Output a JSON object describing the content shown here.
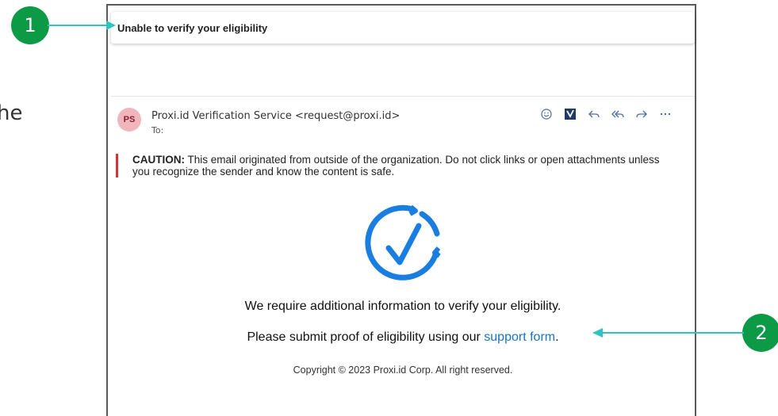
{
  "background": {
    "partial_text": "he"
  },
  "email": {
    "subject": "Unable to verify your eligibility",
    "sender": {
      "initials": "PS",
      "from": "Proxi.id Verification Service <request@proxi.id>",
      "to_label": "To:"
    },
    "toolbar": [
      {
        "icon": "emoji-icon"
      },
      {
        "icon": "forms-icon"
      },
      {
        "icon": "reply-icon"
      },
      {
        "icon": "reply-all-icon"
      },
      {
        "icon": "forward-icon"
      },
      {
        "icon": "more-icon"
      }
    ],
    "caution": {
      "label": "CAUTION:",
      "text": " This email originated from outside of the organization. Do not click links or open attachments unless you recognize the sender and know the content is safe."
    },
    "body": {
      "line1": "We require additional information to verify your eligibility.",
      "line2_prefix": "Please submit proof of eligibility using our ",
      "line2_link": "support form",
      "line2_suffix": ".",
      "copyright": "Copyright © 2023 Proxi.id Corp. All right reserved."
    }
  },
  "callouts": [
    {
      "number": "1"
    },
    {
      "number": "2"
    }
  ],
  "colors": {
    "callout": "#0d9a47",
    "arrow": "#2ec4c4",
    "link": "#1a73c4",
    "logo": "#1a7ee0",
    "caution_bar": "#d13438",
    "avatar": "#f1b6bc"
  }
}
